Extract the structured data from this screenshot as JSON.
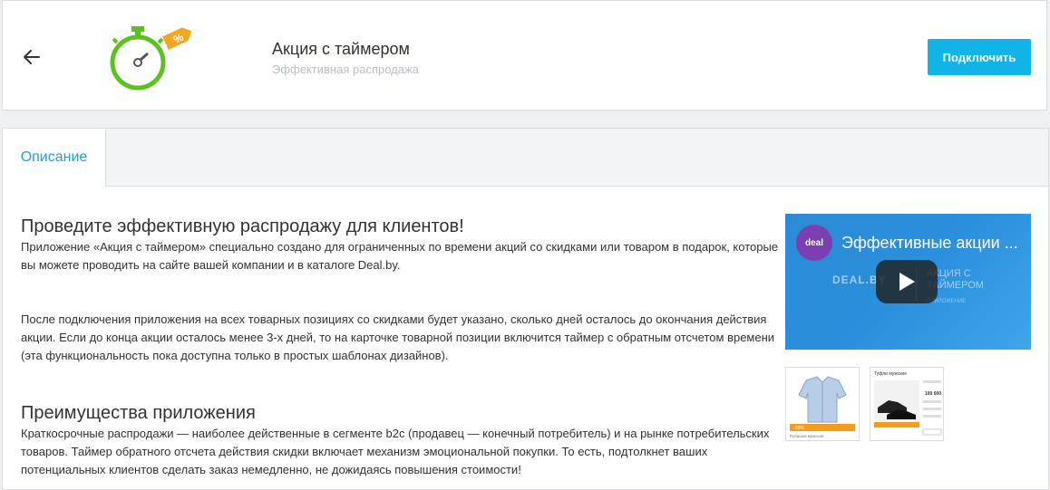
{
  "header": {
    "app_title": "Акция с таймером",
    "app_subtitle": "Эффективная распродажа",
    "connect_label": "Подключить",
    "logo_badge": "%"
  },
  "tabs": [
    {
      "label": "Описание",
      "active": true
    }
  ],
  "content": {
    "heading1": "Проведите эффективную распродажу для клиентов!",
    "para1": "Приложение «Акция с таймером» специально создано для ограниченных по времени акций со скидками или товаром в подарок, которые вы можете проводить на сайте вашей компании и в каталоге Deal.by.",
    "para2": "После подключения приложения на всех товарных позициях со скидками будет указано, сколько дней осталось до окончания действия акции. Если до конца акции осталось менее 3-х дней, то на карточке товарной позиции включится таймер с обратным отсчетом времени (эта функциональность пока доступна только в простых шаблонах дизайнов).",
    "heading2": "Преимущества приложения",
    "para3": "Краткосрочные распродажи — наиболее действенные в сегменте b2c (продавец — конечный потребитель) и на рынке потребительских товаров. Таймер обратного отсчета действия скидки включает механизм эмоциональной покупки. То есть, подтолкнет ваших потенциальных клиентов сделать заказ немедленно, не дожидаясь повышения стоимости!"
  },
  "video": {
    "channel_label": "deal",
    "title": "Эффективные акции ...",
    "bg_left": "DEAL.BY",
    "bg_right": "АКЦИЯ С ТАЙМЕРОМ",
    "bg_small": "ПРИЛОЖЕНИЕ"
  },
  "thumbnails": [
    {
      "caption": "Рубашка мужская",
      "badge": "-15%"
    },
    {
      "caption": "Туфли мужские",
      "price": "100 000"
    }
  ],
  "colors": {
    "accent": "#10b4e6",
    "tab_active_text": "#1aa3d9",
    "logo_green": "#5cc21f",
    "badge_orange": "#f5a623"
  }
}
